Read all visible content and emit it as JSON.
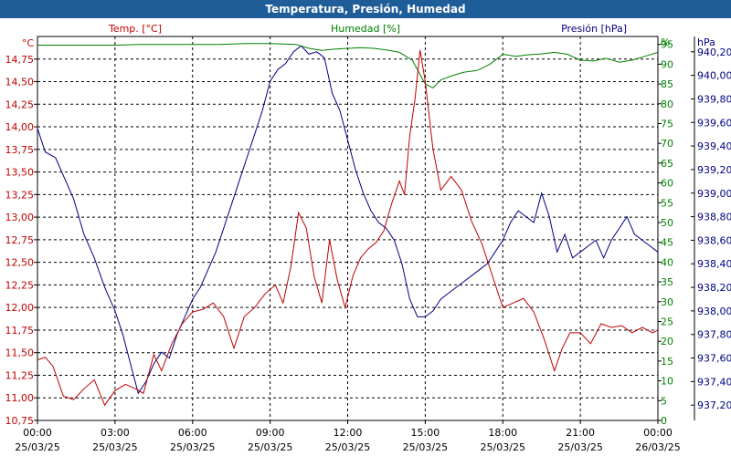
{
  "title": "Temperatura, Presión, Humedad",
  "chart_data": {
    "type": "line",
    "x_range_hours": [
      0,
      24
    ],
    "x_ticks": [
      {
        "hour": 0,
        "time": "00:00",
        "date": "25/03/25"
      },
      {
        "hour": 3,
        "time": "03:00",
        "date": "25/03/25"
      },
      {
        "hour": 6,
        "time": "06:00",
        "date": "25/03/25"
      },
      {
        "hour": 9,
        "time": "09:00",
        "date": "25/03/25"
      },
      {
        "hour": 12,
        "time": "12:00",
        "date": "25/03/25"
      },
      {
        "hour": 15,
        "time": "15:00",
        "date": "25/03/25"
      },
      {
        "hour": 18,
        "time": "18:00",
        "date": "25/03/25"
      },
      {
        "hour": 21,
        "time": "21:00",
        "date": "25/03/25"
      },
      {
        "hour": 24,
        "time": "00:00",
        "date": "26/03/25"
      }
    ],
    "grid": true,
    "axes": {
      "temperature": {
        "label": "Temp. [°C]",
        "unit": "°C",
        "min": 10.75,
        "max": 15.0,
        "color": "#c00000",
        "ticks": [
          "10,75",
          "11,00",
          "11,25",
          "11,50",
          "11,75",
          "12,00",
          "12,25",
          "12,50",
          "12,75",
          "13,00",
          "13,25",
          "13,50",
          "13,75",
          "14,00",
          "14,25",
          "14,50",
          "14,75"
        ]
      },
      "humidity": {
        "label": "Humedad [%]",
        "unit": "%",
        "min": 0,
        "max": 97,
        "color": "#008000",
        "ticks": [
          "0",
          "5",
          "10",
          "15",
          "20",
          "25",
          "30",
          "35",
          "40",
          "45",
          "50",
          "55",
          "60",
          "65",
          "70",
          "75",
          "80",
          "85",
          "90",
          "95"
        ]
      },
      "pressure": {
        "label": "Presión [hPa]",
        "unit": "hPa",
        "min": 937.07,
        "max": 940.33,
        "color": "#000080",
        "ticks": [
          "937,20",
          "937,40",
          "937,60",
          "937,80",
          "938,00",
          "938,20",
          "938,40",
          "938,60",
          "938,80",
          "939,00",
          "939,20",
          "939,40",
          "939,60",
          "939,80",
          "940,00",
          "940,20"
        ]
      }
    },
    "series": [
      {
        "name": "Temp. [°C]",
        "axis": "temperature",
        "color": "#c00000",
        "x": [
          0,
          0.3,
          0.6,
          1.0,
          1.4,
          1.8,
          2.2,
          2.6,
          3.0,
          3.4,
          3.8,
          4.1,
          4.5,
          4.8,
          5.2,
          5.6,
          6.0,
          6.4,
          6.8,
          7.2,
          7.6,
          8.0,
          8.4,
          8.8,
          9.2,
          9.5,
          9.8,
          10.1,
          10.4,
          10.7,
          11.0,
          11.3,
          11.6,
          11.9,
          12.2,
          12.5,
          12.8,
          13.1,
          13.4,
          13.7,
          14.0,
          14.2,
          14.4,
          14.6,
          14.8,
          15.0,
          15.3,
          15.6,
          16.0,
          16.4,
          16.8,
          17.2,
          17.6,
          18.0,
          18.4,
          18.8,
          19.2,
          19.6,
          20.0,
          20.3,
          20.6,
          21.0,
          21.4,
          21.8,
          22.2,
          22.6,
          23.0,
          23.4,
          23.8,
          24.0
        ],
        "y": [
          11.42,
          11.45,
          11.35,
          11.02,
          10.98,
          11.1,
          11.2,
          10.92,
          11.08,
          11.15,
          11.1,
          11.05,
          11.48,
          11.3,
          11.6,
          11.82,
          11.95,
          11.98,
          12.05,
          11.9,
          11.55,
          11.9,
          12.0,
          12.15,
          12.25,
          12.05,
          12.45,
          13.05,
          12.88,
          12.35,
          12.05,
          12.75,
          12.3,
          12.0,
          12.35,
          12.55,
          12.65,
          12.72,
          12.85,
          13.15,
          13.4,
          13.25,
          13.9,
          14.3,
          14.85,
          14.5,
          13.75,
          13.3,
          13.45,
          13.3,
          12.95,
          12.7,
          12.35,
          12.0,
          12.05,
          12.1,
          11.95,
          11.65,
          11.3,
          11.55,
          11.72,
          11.72,
          11.6,
          11.82,
          11.78,
          11.8,
          11.72,
          11.78,
          11.72,
          11.75
        ]
      },
      {
        "name": "Humedad [%]",
        "axis": "humidity",
        "color": "#008000",
        "x": [
          0,
          1,
          2,
          3,
          4,
          5,
          6,
          7,
          8,
          9,
          10,
          10.5,
          11,
          11.5,
          12,
          12.5,
          13,
          13.5,
          14,
          14.5,
          15,
          15.3,
          15.6,
          16,
          16.5,
          17,
          17.5,
          18,
          18.5,
          19,
          19.5,
          20,
          20.5,
          21,
          21.5,
          22,
          22.5,
          23,
          23.5,
          24
        ],
        "y": [
          94.8,
          94.8,
          94.8,
          94.8,
          95,
          95,
          95,
          95,
          95.2,
          95.2,
          95,
          94,
          93.5,
          93.8,
          94,
          94.2,
          94,
          93.6,
          93,
          91,
          85,
          84,
          86,
          87,
          88,
          88.4,
          90,
          92.5,
          92,
          92.4,
          92.6,
          93,
          92.5,
          91,
          90.8,
          91.5,
          90.5,
          91,
          92,
          93
        ]
      },
      {
        "name": "Presión [hPa]",
        "axis": "pressure",
        "color": "#000080",
        "x": [
          0,
          0.3,
          0.7,
          1.0,
          1.4,
          1.8,
          2.2,
          2.6,
          3.0,
          3.3,
          3.6,
          3.9,
          4.2,
          4.5,
          4.8,
          5.1,
          5.4,
          5.7,
          6.0,
          6.3,
          6.6,
          6.9,
          7.2,
          7.5,
          7.8,
          8.1,
          8.4,
          8.7,
          9.0,
          9.3,
          9.6,
          9.9,
          10.2,
          10.5,
          10.8,
          11.1,
          11.4,
          11.7,
          12.0,
          12.3,
          12.6,
          12.9,
          13.2,
          13.5,
          13.8,
          14.1,
          14.4,
          14.7,
          15.0,
          15.3,
          15.6,
          15.9,
          16.2,
          16.5,
          16.8,
          17.1,
          17.4,
          17.7,
          18.0,
          18.3,
          18.6,
          18.9,
          19.2,
          19.5,
          19.8,
          20.1,
          20.4,
          20.7,
          21.0,
          21.3,
          21.6,
          21.9,
          22.2,
          22.5,
          22.8,
          23.1,
          23.4,
          23.7,
          24.0
        ],
        "y": [
          939.55,
          939.35,
          939.3,
          939.15,
          938.95,
          938.65,
          938.45,
          938.2,
          938.0,
          937.8,
          937.55,
          937.3,
          937.4,
          937.55,
          937.65,
          937.6,
          937.8,
          937.95,
          938.1,
          938.2,
          938.35,
          938.5,
          938.7,
          938.9,
          939.1,
          939.3,
          939.5,
          939.7,
          939.95,
          940.05,
          940.1,
          940.2,
          940.25,
          940.18,
          940.2,
          940.15,
          939.85,
          939.7,
          939.45,
          939.2,
          939.0,
          938.85,
          938.75,
          938.7,
          938.6,
          938.4,
          938.1,
          937.95,
          937.95,
          938.0,
          938.1,
          938.15,
          938.2,
          938.25,
          938.3,
          938.35,
          938.4,
          938.5,
          938.6,
          938.75,
          938.85,
          938.8,
          938.75,
          939.0,
          938.8,
          938.5,
          938.65,
          938.45,
          938.5,
          938.55,
          938.6,
          938.45,
          938.6,
          938.7,
          938.8,
          938.65,
          938.6,
          938.55,
          938.5
        ]
      }
    ]
  }
}
